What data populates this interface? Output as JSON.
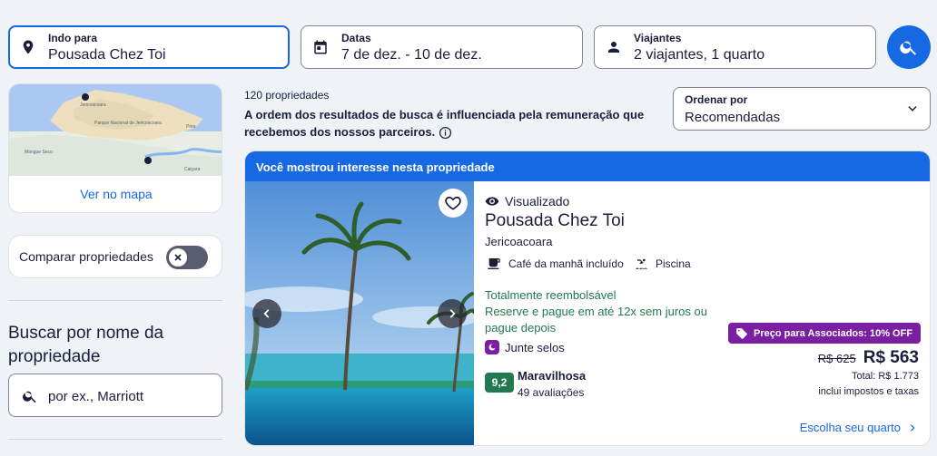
{
  "search": {
    "destination": {
      "label": "Indo para",
      "value": "Pousada Chez Toi"
    },
    "dates": {
      "label": "Datas",
      "value": "7 de dez. - 10 de dez."
    },
    "travelers": {
      "label": "Viajantes",
      "value": "2 viajantes, 1 quarto"
    }
  },
  "map": {
    "link": "Ver no mapa",
    "labels": [
      "Prea",
      "Mangue Seco",
      "Jericoacoara",
      "Parque Nacional de Jericoacoara",
      "Caiçara"
    ]
  },
  "compare": {
    "label": "Comparar propriedades",
    "enabled": false
  },
  "name_search": {
    "title": "Buscar por nome da propriedade",
    "placeholder": "por ex., Marriott"
  },
  "results": {
    "count": "120 propriedades",
    "disclaimer": "A ordem dos resultados de busca é influenciada pela remuneração que recebemos dos nossos parceiros."
  },
  "sort": {
    "label": "Ordenar por",
    "value": "Recomendadas"
  },
  "card": {
    "banner": "Você mostrou interesse nesta propriedade",
    "viewed": "Visualizado",
    "name": "Pousada Chez Toi",
    "city": "Jericoacoara",
    "amenities": [
      "Café da manhã incluído",
      "Piscina"
    ],
    "refund": "Totalmente reembolsável",
    "pay_later": "Reserve e pague em até 12x sem juros ou pague depois",
    "stamps": "Junte selos",
    "score": "9,2",
    "rating_word": "Maravilhosa",
    "rating_count": "49 avaliações",
    "member_badge": "Preço para Associados: 10% OFF",
    "old_price": "R$ 625",
    "new_price": "R$ 563",
    "total": "Total: R$ 1.773",
    "taxes": "inclui impostos e taxas",
    "choose_room": "Escolha seu quarto"
  },
  "colors": {
    "primary": "#1668e3",
    "member": "#7b1fa2",
    "success": "#227950",
    "page_bg": "#eff3f7"
  }
}
